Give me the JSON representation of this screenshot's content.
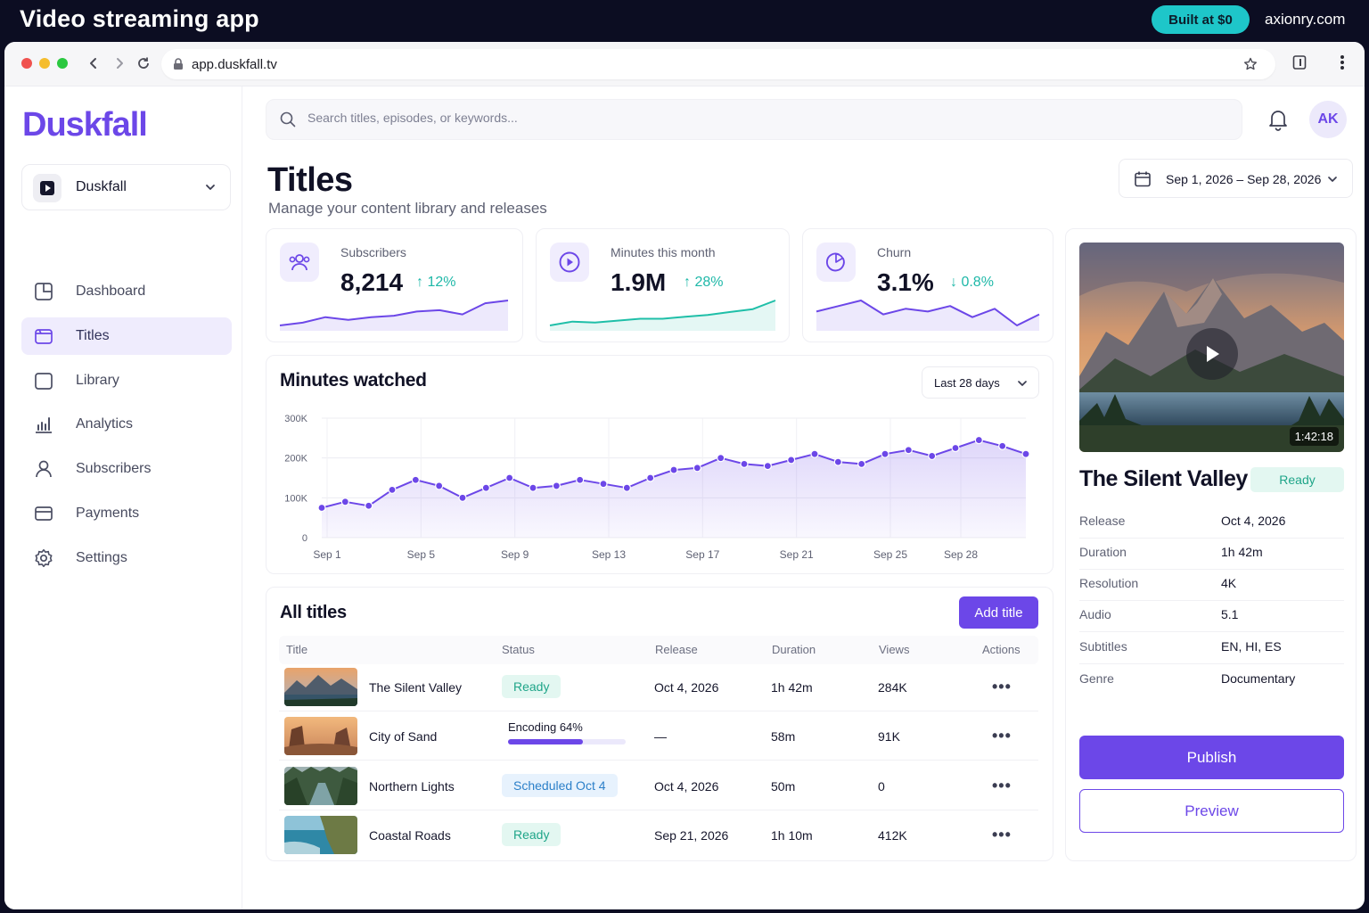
{
  "promo": {
    "title": "Video streaming app",
    "badge": "Built at $0",
    "site": "axionry.com"
  },
  "browser": {
    "url": "app.duskfall.tv"
  },
  "brand": {
    "logo": "Duskfall",
    "accent": "#6c47e8"
  },
  "workspace": {
    "label": "Duskfall"
  },
  "sidebar": {
    "items": [
      {
        "label": "Dashboard",
        "icon": "dashboard-icon",
        "active": false
      },
      {
        "label": "Titles",
        "icon": "titles-icon",
        "active": true
      },
      {
        "label": "Library",
        "icon": "library-icon",
        "active": false
      },
      {
        "label": "Analytics",
        "icon": "analytics-icon",
        "active": false
      },
      {
        "label": "Subscribers",
        "icon": "user-icon",
        "active": false
      },
      {
        "label": "Payments",
        "icon": "card-icon",
        "active": false
      },
      {
        "label": "Settings",
        "icon": "gear-icon",
        "active": false
      }
    ]
  },
  "header": {
    "search_placeholder": "Search titles, episodes, or keywords...",
    "avatar": "AK",
    "title": "Titles",
    "subtitle": "Manage your content library and releases",
    "date_range": "Sep 1, 2026 – Sep 28, 2026"
  },
  "stats": [
    {
      "label": "Subscribers",
      "value": "8,214",
      "delta": "12%",
      "direction": "up",
      "spark": [
        4,
        6,
        10,
        8,
        10,
        11,
        14,
        15,
        12,
        20,
        22
      ]
    },
    {
      "label": "Minutes this month",
      "value": "1.9M",
      "delta": "28%",
      "direction": "up",
      "spark": [
        4,
        8,
        7,
        9,
        11,
        11,
        13,
        15,
        18,
        21,
        30
      ]
    },
    {
      "label": "Churn",
      "value": "3.1%",
      "delta": "0.8%",
      "direction": "down",
      "spark": [
        14,
        16,
        18,
        13,
        15,
        14,
        16,
        12,
        15,
        9,
        13
      ]
    }
  ],
  "chart_data": {
    "type": "line",
    "title": "Minutes watched",
    "range_label": "Last 28 days",
    "x": [
      "Sep 1",
      "Sep 2",
      "Sep 3",
      "Sep 4",
      "Sep 5",
      "Sep 6",
      "Sep 7",
      "Sep 8",
      "Sep 9",
      "Sep 10",
      "Sep 11",
      "Sep 12",
      "Sep 13",
      "Sep 14",
      "Sep 15",
      "Sep 16",
      "Sep 17",
      "Sep 18",
      "Sep 19",
      "Sep 20",
      "Sep 21",
      "Sep 22",
      "Sep 23",
      "Sep 24",
      "Sep 25",
      "Sep 26",
      "Sep 27",
      "Sep 28",
      "Sep 29",
      "Sep 30",
      "Oct 1"
    ],
    "values": [
      75000,
      90000,
      80000,
      120000,
      145000,
      130000,
      100000,
      125000,
      150000,
      125000,
      130000,
      145000,
      135000,
      125000,
      150000,
      170000,
      175000,
      200000,
      185000,
      180000,
      195000,
      210000,
      190000,
      185000,
      210000,
      220000,
      205000,
      225000,
      245000,
      230000,
      210000
    ],
    "xticks": [
      "Sep 1",
      "Sep 5",
      "Sep 9",
      "Sep 13",
      "Sep 17",
      "Sep 21",
      "Sep 25",
      "Sep 28"
    ],
    "yticks": [
      "0",
      "100K",
      "200K",
      "300K"
    ],
    "ylim": [
      0,
      300000
    ],
    "grid": true
  },
  "table": {
    "title": "All titles",
    "add_label": "Add title",
    "columns": [
      "Title",
      "Status",
      "Release",
      "Duration",
      "Views",
      "Actions"
    ],
    "rows": [
      {
        "title": "The Silent Valley",
        "status": "Ready",
        "status_type": "ready",
        "release": "Oct 4, 2026",
        "duration": "1h 42m",
        "views": "284K",
        "actions": "•••"
      },
      {
        "title": "City of Sand",
        "status": "Encoding 64%",
        "status_type": "encoding",
        "progress": 0.64,
        "release": "—",
        "duration": "58m",
        "views": "91K",
        "actions": "•••"
      },
      {
        "title": "Northern Lights",
        "status": "Scheduled Oct 4",
        "status_type": "scheduled",
        "release": "Oct 4, 2026",
        "duration": "50m",
        "views": "0",
        "actions": "•••"
      },
      {
        "title": "Coastal Roads",
        "status": "Ready",
        "status_type": "ready",
        "release": "Sep 21, 2026",
        "duration": "1h 10m",
        "views": "412K",
        "actions": "•••"
      }
    ]
  },
  "detail": {
    "timecode": "1:42:18",
    "title": "The Silent Valley",
    "status": "Ready",
    "meta": [
      {
        "k": "Release",
        "v": "Oct 4, 2026"
      },
      {
        "k": "Duration",
        "v": "1h 42m"
      },
      {
        "k": "Resolution",
        "v": "4K"
      },
      {
        "k": "Audio",
        "v": "5.1"
      },
      {
        "k": "Subtitles",
        "v": "EN, HI, ES"
      },
      {
        "k": "Genre",
        "v": "Documentary"
      }
    ],
    "publish_label": "Publish",
    "preview_label": "Preview"
  }
}
